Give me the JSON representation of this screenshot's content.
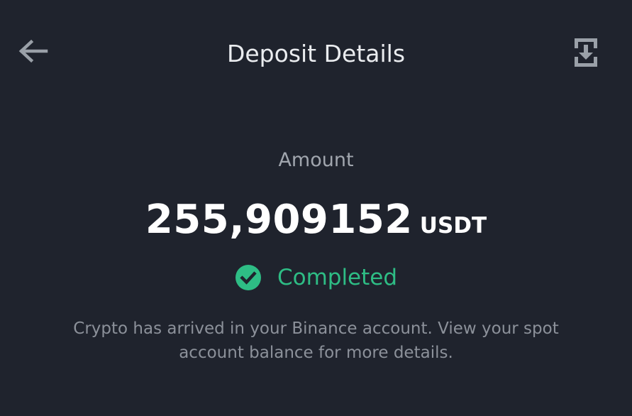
{
  "header": {
    "title": "Deposit Details",
    "back_icon": "arrow-left-icon",
    "save_icon": "download-save-icon"
  },
  "amount": {
    "label": "Amount",
    "value": "255,909152",
    "unit": "USDT"
  },
  "status": {
    "text": "Completed",
    "icon": "check-circle-icon",
    "color": "#2ebd85"
  },
  "description": "Crypto has arrived in your Binance account. View your spot account balance for more details.",
  "colors": {
    "background": "#1f232d",
    "title": "#eaecef",
    "muted": "#8c919a",
    "success": "#2ebd85"
  }
}
